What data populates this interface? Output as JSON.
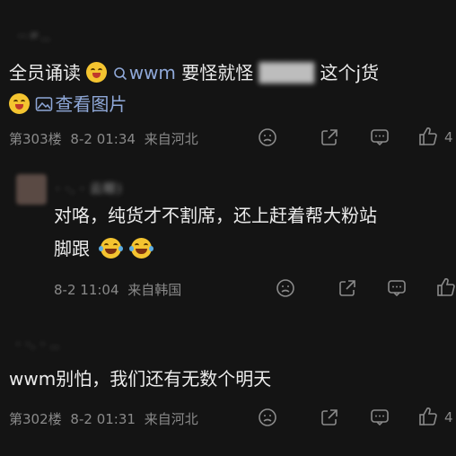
{
  "comments": [
    {
      "username": "··〃.. ",
      "text_prefix": "全员诵读",
      "link_text": "wwm",
      "text_middle": "要怪就怪",
      "blurred_text": "████",
      "text_suffix": "这个j货",
      "view_image_label": "查看图片",
      "floor": "第303楼",
      "date": "8-2",
      "time": "01:34",
      "location": "来自河北",
      "like_count": "4"
    },
    {
      "username": "·  ·. · 云眼)",
      "text_line1": "对咯，纯货才不割席，还上赶着帮大粉站",
      "text_line2": "脚跟",
      "date": "8-2",
      "time": "11:04",
      "location": "来自韩国"
    },
    {
      "username": "· ·. · .. ",
      "text": "wwm别怕，我们还有无数个明天",
      "floor": "第302楼",
      "date": "8-2",
      "time": "01:31",
      "location": "来自河北",
      "like_count": "4"
    }
  ],
  "icons": {
    "search": "search-icon",
    "image": "image-icon",
    "sad": "sad-face-icon",
    "share": "share-icon",
    "comment": "comment-icon",
    "like": "thumbs-up-icon"
  },
  "colors": {
    "background": "#141414",
    "text": "#ececec",
    "meta": "#8a8a8a",
    "link": "#8fa8d8"
  }
}
